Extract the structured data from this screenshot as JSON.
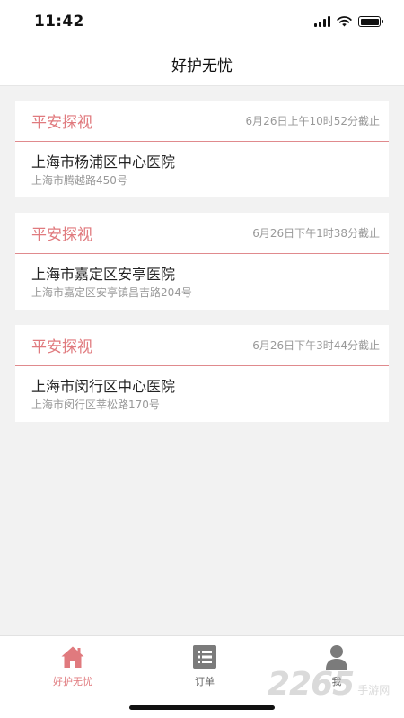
{
  "status_bar": {
    "time": "11:42"
  },
  "nav": {
    "title": "好护无忧"
  },
  "orders": [
    {
      "type": "平安探视",
      "deadline": "6月26日上午10时52分截止",
      "hospital": "上海市杨浦区中心医院",
      "address": "上海市腾越路450号"
    },
    {
      "type": "平安探视",
      "deadline": "6月26日下午1时38分截止",
      "hospital": "上海市嘉定区安亭医院",
      "address": "上海市嘉定区安亭镇昌吉路204号"
    },
    {
      "type": "平安探视",
      "deadline": "6月26日下午3时44分截止",
      "hospital": "上海市闵行区中心医院",
      "address": "上海市闵行区莘松路170号"
    }
  ],
  "tabs": [
    {
      "label": "好护无忧",
      "icon": "home-icon",
      "active": true
    },
    {
      "label": "订单",
      "icon": "list-icon",
      "active": false
    },
    {
      "label": "我",
      "icon": "user-icon",
      "active": false
    }
  ],
  "watermark": {
    "number": "2265",
    "text": "手游网"
  },
  "colors": {
    "accent": "#e07a7e",
    "divider": "#e08a8d",
    "background": "#f2f2f2",
    "icon_gray": "#7b7b7b"
  }
}
